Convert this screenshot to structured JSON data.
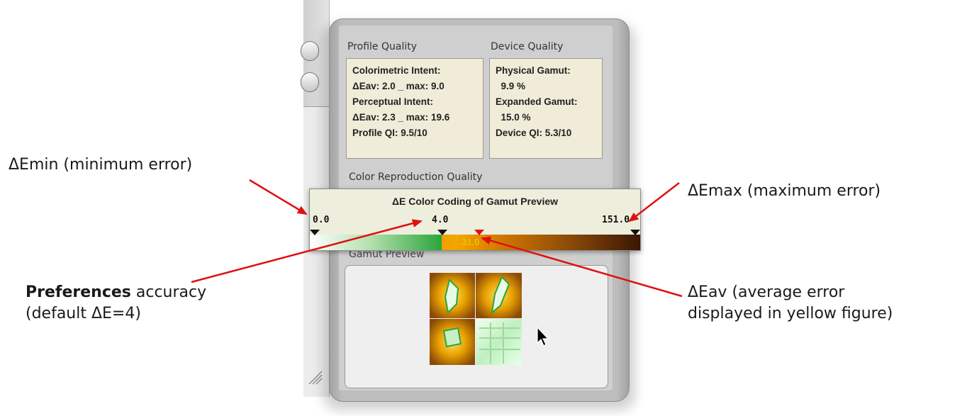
{
  "annotations": {
    "emin": "ΔEmin (minimum error)",
    "emax": "ΔEmax (maximum error)",
    "prefs_bold": "Preferences",
    "prefs_rest": " accuracy",
    "prefs_line2": "(default ΔE=4)",
    "eav_line1": "ΔEav (average error",
    "eav_line2": "displayed in yellow figure)"
  },
  "panel": {
    "profile_quality": {
      "label": "Profile Quality",
      "lines": [
        "Colorimetric Intent:",
        "ΔEav: 2.0 _ max: 9.0",
        "Perceptual Intent:",
        "ΔEav: 2.3 _ max: 19.6",
        "Profile QI: 9.5/10"
      ]
    },
    "device_quality": {
      "label": "Device Quality",
      "lines": [
        "Physical Gamut:",
        "  9.9 %",
        "Expanded Gamut:",
        "  15.0 %",
        "Device QI: 5.3/10"
      ]
    },
    "color_repro_label": "Color Reproduction Quality",
    "gamut_preview_label": "Gamut Preview"
  },
  "popup": {
    "title": "ΔE Color Coding of Gamut Preview",
    "min": "0.0",
    "threshold": "4.0",
    "max": "151.0",
    "average": "31.0"
  },
  "colors": {
    "annotation_arrow": "#e01010",
    "good_green": "#2aa53a",
    "warn_orange": "#f0a000",
    "bad_brown": "#3a1604",
    "avg_text": "#e9c400"
  }
}
